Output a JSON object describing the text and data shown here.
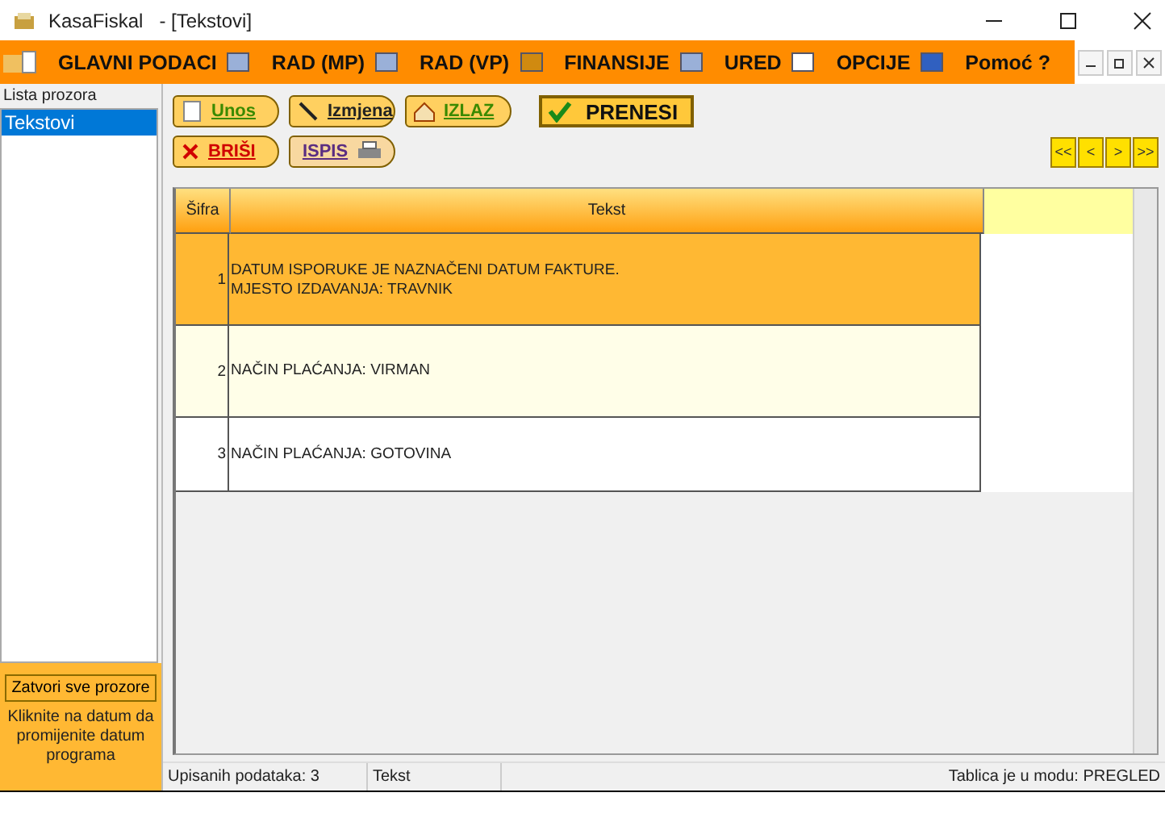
{
  "window": {
    "title": "KasaFiskal   - [Tekstovi]"
  },
  "menu": [
    "GLAVNI PODACI",
    "RAD (MP)",
    "RAD (VP)",
    "FINANSIJE",
    "URED",
    "OPCIJE",
    "Pomoć ?"
  ],
  "sidebar": {
    "title": "Lista prozora",
    "items": [
      {
        "label": "Tekstovi",
        "selected": true
      }
    ],
    "close_all": "Zatvori sve prozore",
    "hint": "Kliknite na datum da promijenite datum programa"
  },
  "toolbar": {
    "row1": [
      {
        "label": "Unos",
        "kind": "add"
      },
      {
        "label": "Izmjena",
        "kind": "edit"
      },
      {
        "label": "IZLAZ",
        "kind": "exit"
      }
    ],
    "confirm": "PRENESI",
    "row2": [
      {
        "label": "BRIŠI",
        "kind": "delete"
      },
      {
        "label": "ISPIS",
        "kind": "print"
      }
    ],
    "nav": [
      "<<",
      "<",
      ">",
      ">>"
    ]
  },
  "table": {
    "columns": [
      "Šifra",
      "Tekst"
    ],
    "rows": [
      {
        "code": "1",
        "text": "DATUM ISPORUKE JE NAZNAČENI DATUM FAKTURE.\nMJESTO IZDAVANJA: TRAVNIK",
        "selected": true
      },
      {
        "code": "2",
        "text": "NAČIN PLAĆANJA: VIRMAN",
        "selected": false
      },
      {
        "code": "3",
        "text": "NAČIN PLAĆANJA: GOTOVINA",
        "selected": false
      }
    ]
  },
  "status_bar": [
    "Upisanih podataka: 3",
    "Tekst",
    "Tablica je u modu: PREGLED"
  ]
}
